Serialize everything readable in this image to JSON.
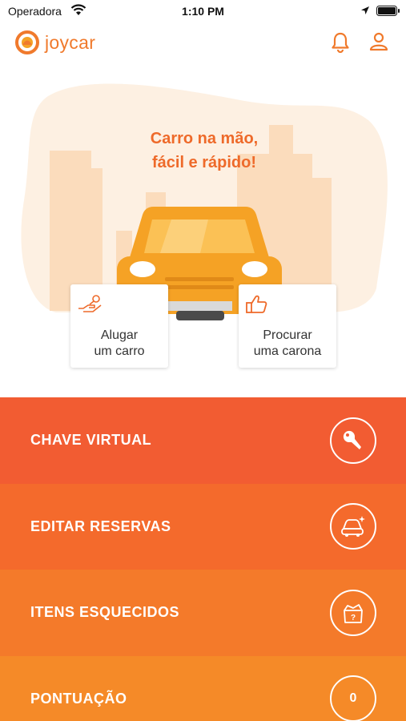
{
  "status_bar": {
    "carrier": "Operadora",
    "time": "1:10 PM"
  },
  "header": {
    "logo_text": "joycar"
  },
  "hero": {
    "tagline_line1": "Carro na mão,",
    "tagline_line2": "fácil e rápido!",
    "actions": [
      {
        "line1": "Alugar",
        "line2": "um carro",
        "icon": "hand-key-icon"
      },
      {
        "line1": "Procurar",
        "line2": "uma carona",
        "icon": "thumbs-up-icon"
      }
    ]
  },
  "menu": [
    {
      "label": "CHAVE VIRTUAL",
      "icon": "car-key-icon",
      "color": "#f25c32"
    },
    {
      "label": "EDITAR RESERVAS",
      "icon": "car-edit-icon",
      "color": "#f46a2c"
    },
    {
      "label": "ITENS ESQUECIDOS",
      "icon": "lost-items-box-icon",
      "color": "#f47a2a"
    },
    {
      "label": "PONTUAÇÃO",
      "value": "0",
      "color": "#f58a28"
    }
  ],
  "colors": {
    "accent": "#f07a2c",
    "car": "#f5a225",
    "hero_bg": "#fdeedd"
  }
}
